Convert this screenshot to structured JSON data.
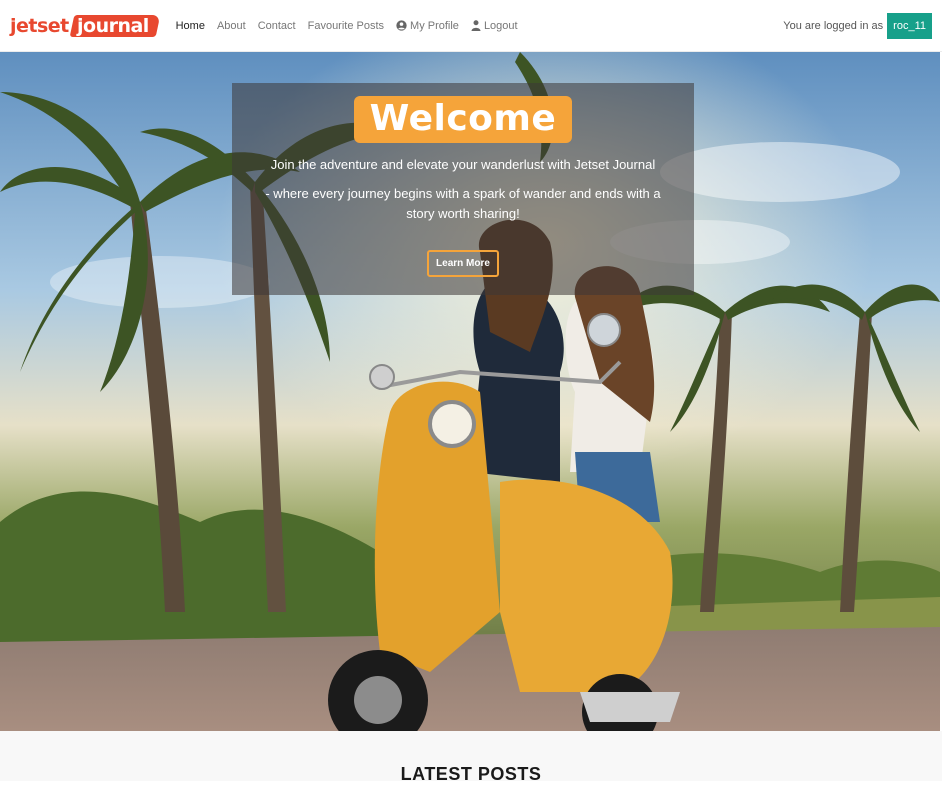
{
  "brand": {
    "logo_part1": "jetset",
    "logo_part2": "journal",
    "accent_color": "#e8482f"
  },
  "nav": {
    "items": [
      {
        "label": "Home",
        "active": true
      },
      {
        "label": "About"
      },
      {
        "label": "Contact"
      },
      {
        "label": "Favourite Posts"
      },
      {
        "label": "My Profile",
        "icon": "user-circle-icon"
      },
      {
        "label": "Logout",
        "icon": "user-icon"
      }
    ],
    "logged_in_text": "You are logged in as",
    "username": "roc_11",
    "username_badge_color": "#17a08a"
  },
  "hero": {
    "welcome": "Welcome",
    "tagline": "Join the adventure and elevate your wanderlust with Jetset Journal",
    "tagline2": "- where every journey begins with a spark of wander and ends with a story worth sharing!",
    "cta_label": "Learn More",
    "welcome_bg": "#f5a43a"
  },
  "latest": {
    "title": "LATEST POSTS"
  }
}
